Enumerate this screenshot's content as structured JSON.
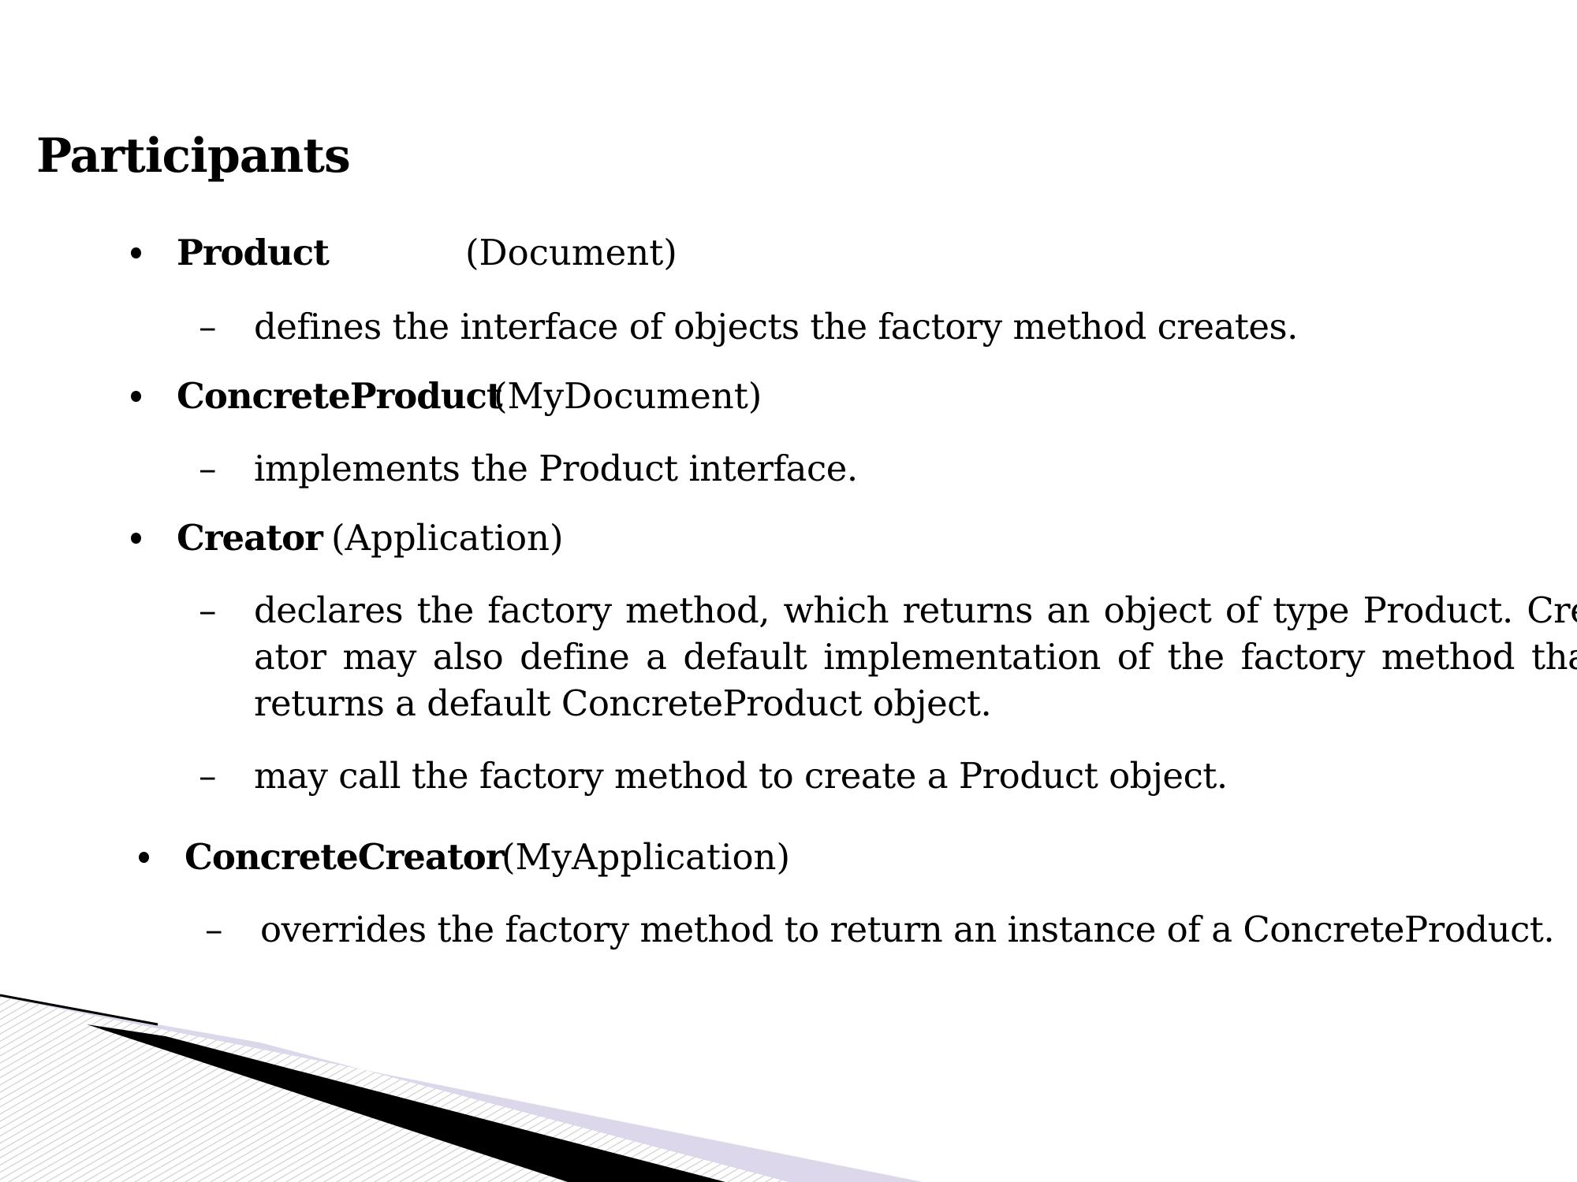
{
  "title": "Participants",
  "participants": [
    {
      "name": "Product",
      "example": "(Document)",
      "responsibilities": [
        "defines the interface of objects the factory method creates."
      ]
    },
    {
      "name": "ConcreteProduct",
      "example": "(MyDocument)",
      "responsibilities": [
        "implements the Product interface."
      ]
    },
    {
      "name": "Creator",
      "example": "(Application)",
      "responsibilities": [
        "declares the factory method, which returns an object of type Product. Cre-ator may also define a default implementation of the factory method that returns a default ConcreteProduct object.",
        "may call the factory method to create a Product object."
      ]
    },
    {
      "name": "ConcreteCreator",
      "example": "(MyApplication)",
      "responsibilities": [
        "overrides the factory method to return an instance of a ConcreteProduct."
      ]
    }
  ],
  "dash_glyph": "–",
  "colors": {
    "background": "#ffffff",
    "text": "#000000",
    "accent_band": "#dcd7ea",
    "dark_band": "#000000",
    "hatch": "#c9c9c9"
  }
}
